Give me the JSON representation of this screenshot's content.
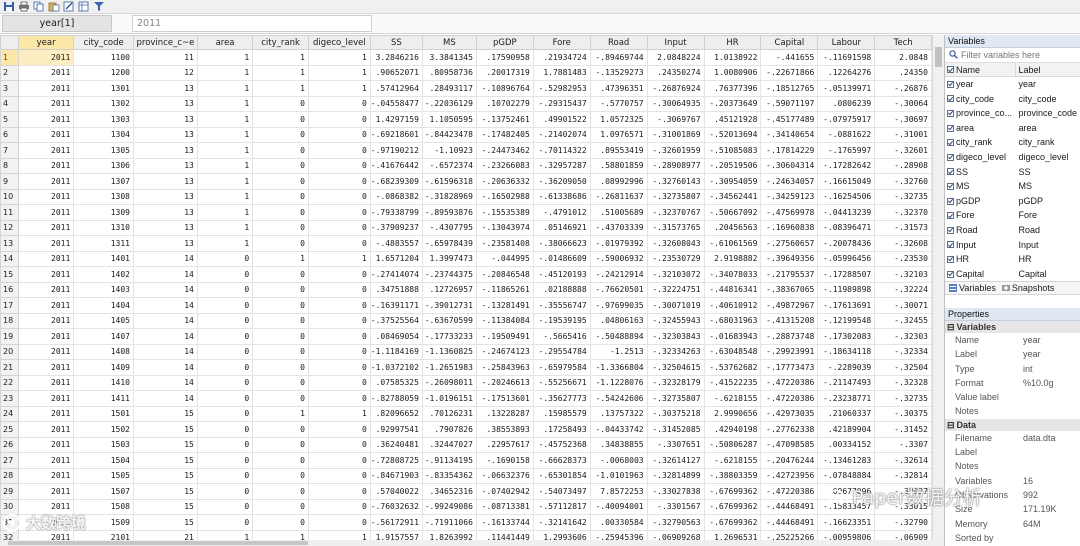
{
  "toolbar": {
    "icons": [
      "save-icon",
      "print-icon",
      "copy-icon",
      "paste-icon",
      "edit-icon",
      "browse-icon",
      "filter-icon"
    ]
  },
  "editbar": {
    "varname": "year[1]",
    "value": "2011"
  },
  "grid": {
    "columns": [
      "year",
      "city_code",
      "province_c~e",
      "area",
      "city_rank",
      "digeco_level",
      "SS",
      "MS",
      "pGDP",
      "Fore",
      "Road",
      "Input",
      "HR",
      "Capital",
      "Labour",
      "Tech"
    ],
    "rows": [
      [
        "1",
        "2011",
        "1100",
        "11",
        "1",
        "1",
        "1",
        "3.2846216",
        "3.3841345",
        ".17590958",
        ".21934724",
        "-.89469744",
        "2.0848224",
        "1.0138922",
        "-.441655",
        "-.11691598",
        "2.0848"
      ],
      [
        "2",
        "2011",
        "1200",
        "12",
        "1",
        "1",
        "1",
        ".90652071",
        ".80958736",
        ".20017319",
        "1.7881483",
        "-.13529273",
        ".24350274",
        "1.0080906",
        "-.22671866",
        ".12264276",
        ".24350"
      ],
      [
        "3",
        "2011",
        "1301",
        "13",
        "1",
        "1",
        "1",
        ".57412964",
        ".28493117",
        "-.10896764",
        "-.52982953",
        ".47396351",
        "-.26876924",
        ".76377396",
        "-.18512765",
        "-.05139971",
        "-.26876"
      ],
      [
        "4",
        "2011",
        "1302",
        "13",
        "1",
        "0",
        "0",
        "-.04558477",
        "-.22036129",
        ".10702279",
        "-.29315437",
        "-.5770757",
        "-.30064935",
        "-.20373649",
        "-.59071197",
        ".0806239",
        "-.30064"
      ],
      [
        "5",
        "2011",
        "1303",
        "13",
        "1",
        "0",
        "0",
        "1.4297159",
        "1.1050595",
        "-.13752461",
        ".49901522",
        "1.0572325",
        "-.3069767",
        ".45121928",
        "-.45177489",
        "-.07975917",
        "-.30697"
      ],
      [
        "6",
        "2011",
        "1304",
        "13",
        "1",
        "0",
        "0",
        "-.69218601",
        "-.84423478",
        "-.17482405",
        "-.21402074",
        "1.0976571",
        "-.31001869",
        "-.52013694",
        "-.34140654",
        "-.0881622",
        "-.31001"
      ],
      [
        "7",
        "2011",
        "1305",
        "13",
        "1",
        "0",
        "0",
        "-.97190212",
        "-1.10923",
        "-.24473462",
        "-.70114322",
        ".89553419",
        "-.32601959",
        "-.51085083",
        "-.17814229",
        "-.1765997",
        "-.32601"
      ],
      [
        "8",
        "2011",
        "1306",
        "13",
        "1",
        "0",
        "0",
        "-.41676442",
        "-.6572374",
        "-.23266083",
        "-.32957287",
        ".58801859",
        "-.28908977",
        "-.20519506",
        "-.30604314",
        "-.17282642",
        "-.28908"
      ],
      [
        "9",
        "2011",
        "1307",
        "13",
        "1",
        "0",
        "0",
        "-.68239309",
        "-.61596318",
        "-.20636332",
        "-.36209050",
        ".08992996",
        "-.32760143",
        "-.30954059",
        "-.24634057",
        "-.16615049",
        "-.32760"
      ],
      [
        "10",
        "2011",
        "1308",
        "13",
        "1",
        "0",
        "0",
        "-.0868382",
        "-.31828969",
        "-.16502988",
        "-.61338686",
        "-.26811637",
        "-.32735807",
        "-.34562441",
        "-.34259123",
        "-.16254506",
        "-.32735"
      ],
      [
        "11",
        "2011",
        "1309",
        "13",
        "1",
        "0",
        "0",
        "-.79338799",
        "-.89593876",
        "-.15535389",
        "-.4791012",
        ".51005689",
        "-.32370767",
        "-.50667092",
        "-.47569978",
        "-.04413239",
        "-.32370"
      ],
      [
        "12",
        "2011",
        "1310",
        "13",
        "1",
        "0",
        "0",
        "-.37909237",
        "-.4307795",
        "-.13043974",
        ".05146921",
        "-.43703339",
        "-.31573765",
        ".20456563",
        "-.16960838",
        "-.08396471",
        "-.31573"
      ],
      [
        "13",
        "2011",
        "1311",
        "13",
        "1",
        "0",
        "0",
        "-.4883557",
        "-.65978439",
        "-.23581408",
        "-.38066623",
        "-.01979392",
        "-.32608043",
        "-.61061569",
        "-.27560657",
        "-.20078436",
        "-.32608"
      ],
      [
        "14",
        "2011",
        "1401",
        "14",
        "0",
        "1",
        "1",
        "1.6571204",
        "1.3997473",
        "-.044995",
        "-.01486609",
        "-.59006932",
        "-.23530729",
        "2.9198882",
        "-.39649356",
        "-.05996456",
        "-.23530"
      ],
      [
        "15",
        "2011",
        "1402",
        "14",
        "0",
        "0",
        "0",
        "-.27414074",
        "-.23744375",
        "-.20846548",
        "-.45120193",
        "-.24212914",
        "-.32103072",
        "-.34078033",
        "-.21795537",
        "-.17288507",
        "-.32103"
      ],
      [
        "16",
        "2011",
        "1403",
        "14",
        "0",
        "0",
        "0",
        ".34751888",
        ".12726957",
        "-.11865261",
        ".02188888",
        "-.76620501",
        "-.32224751",
        "-.44816341",
        "-.38367065",
        "-.11989898",
        "-.32224"
      ],
      [
        "17",
        "2011",
        "1404",
        "14",
        "0",
        "0",
        "0",
        "-.16391171",
        "-.39012731",
        "-.13281491",
        "-.35556747",
        "-.97699035",
        "-.30071019",
        "-.40610912",
        "-.49872967",
        "-.17613691",
        "-.30071"
      ],
      [
        "18",
        "2011",
        "1405",
        "14",
        "0",
        "0",
        "0",
        "-.37525564",
        "-.63670599",
        "-.11384084",
        "-.19539195",
        ".04806163",
        "-.32455943",
        "-.68031963",
        "-.41315208",
        "-.12199548",
        "-.32455"
      ],
      [
        "19",
        "2011",
        "1407",
        "14",
        "0",
        "0",
        "0",
        ".08469054",
        "-.17733233",
        "-.19509491",
        "-.5665416",
        "-.50488894",
        "-.32303843",
        "-.01683943",
        "-.28873748",
        "-.17302083",
        "-.32303"
      ],
      [
        "20",
        "2011",
        "1408",
        "14",
        "0",
        "0",
        "0",
        "-1.1184169",
        "-1.1360825",
        "-.24674123",
        "-.29554784",
        "-1.2513",
        "-.32334263",
        "-.63048548",
        "-.29923991",
        "-.18634118",
        "-.32334"
      ],
      [
        "21",
        "2011",
        "1409",
        "14",
        "0",
        "0",
        "0",
        "-1.0372102",
        "-1.2651983",
        "-.25843963",
        "-.65979584",
        "-1.3366804",
        "-.32504615",
        "-.53762682",
        "-.17773473",
        "-.2289039",
        "-.32504"
      ],
      [
        "22",
        "2011",
        "1410",
        "14",
        "0",
        "0",
        "0",
        ".07585325",
        "-.26098011",
        "-.20246613",
        "-.55256671",
        "-1.1228076",
        "-.32328179",
        "-.41522235",
        "-.47220386",
        "-.21147493",
        "-.32328"
      ],
      [
        "23",
        "2011",
        "1411",
        "14",
        "0",
        "0",
        "0",
        "-.82788059",
        "-1.0196151",
        "-.17513601",
        "-.35627773",
        "-.54242606",
        "-.32735807",
        "-.6218155",
        "-.47220386",
        "-.23238771",
        "-.32735"
      ],
      [
        "24",
        "2011",
        "1501",
        "15",
        "0",
        "1",
        "1",
        ".82096652",
        ".70126231",
        ".13228287",
        ".15985579",
        ".13757322",
        "-.30375218",
        "2.9990656",
        "-.42973035",
        ".21060337",
        "-.30375"
      ],
      [
        "25",
        "2011",
        "1502",
        "15",
        "0",
        "0",
        "0",
        ".92997541",
        ".7907826",
        ".38553893",
        ".17258493",
        "-.04433742",
        "-.31452085",
        ".42940198",
        "-.27762338",
        ".42189904",
        "-.31452"
      ],
      [
        "26",
        "2011",
        "1503",
        "15",
        "0",
        "0",
        "0",
        ".36240481",
        ".32447027",
        ".22957617",
        "-.45752368",
        ".34838855",
        "-.3307651",
        "-.50806287",
        "-.47098585",
        ".00334152",
        "-.3307"
      ],
      [
        "27",
        "2011",
        "1504",
        "15",
        "0",
        "0",
        "0",
        "-.72808725",
        "-.91134195",
        "-.1690158",
        "-.66628373",
        "-.0068003",
        "-.32614127",
        "-.6218155",
        "-.20476244",
        "-.13461283",
        "-.32614"
      ],
      [
        "28",
        "2011",
        "1505",
        "15",
        "0",
        "0",
        "0",
        "-.84671903",
        "-.83354362",
        "-.06632376",
        "-.65301854",
        "-1.0101963",
        "-.32814899",
        "-.38803359",
        "-.42723956",
        "-.07848884",
        "-.32814"
      ],
      [
        "29",
        "2011",
        "1507",
        "15",
        "0",
        "0",
        "0",
        ".57040022",
        ".34652316",
        "-.07402942",
        "-.54073497",
        "7.8572253",
        "-.33027838",
        "-.67699362",
        "-.47220386",
        ".09677096",
        "-.33027"
      ],
      [
        "30",
        "2011",
        "1508",
        "15",
        "0",
        "0",
        "0",
        "-.76032632",
        "-.99249086",
        "-.08713381",
        "-.57112817",
        "-.40094001",
        "-.3301567",
        "-.67699362",
        "-.44468491",
        "-.15833457",
        "-.33015"
      ],
      [
        "31",
        "2011",
        "1509",
        "15",
        "0",
        "0",
        "0",
        "-.56172911",
        "-.71911066",
        "-.16133744",
        "-.32141642",
        ".00330584",
        "-.32790563",
        "-.67699362",
        "-.44468491",
        "-.16623351",
        "-.32790"
      ],
      [
        "32",
        "2011",
        "2101",
        "21",
        "1",
        "1",
        "1",
        "1.9157557",
        "1.8263992",
        ".11441449",
        "1.2993606",
        "-.25945396",
        "-.06909268",
        "1.2696531",
        "-.25225266",
        "-.00959806",
        "-.06909"
      ]
    ]
  },
  "variables_panel": {
    "title": "Variables",
    "filter_placeholder": "Filter variables here",
    "col_name": "Name",
    "col_label": "Label",
    "items": [
      {
        "name": "year",
        "label": "year"
      },
      {
        "name": "city_code",
        "label": "city_code"
      },
      {
        "name": "province_co...",
        "label": "province_code"
      },
      {
        "name": "area",
        "label": "area"
      },
      {
        "name": "city_rank",
        "label": "city_rank"
      },
      {
        "name": "digeco_level",
        "label": "digeco_level"
      },
      {
        "name": "SS",
        "label": "SS"
      },
      {
        "name": "MS",
        "label": "MS"
      },
      {
        "name": "pGDP",
        "label": "pGDP"
      },
      {
        "name": "Fore",
        "label": "Fore"
      },
      {
        "name": "Road",
        "label": "Road"
      },
      {
        "name": "Input",
        "label": "Input"
      },
      {
        "name": "HR",
        "label": "HR"
      },
      {
        "name": "Capital",
        "label": "Capital"
      }
    ],
    "tab_variables": "Variables",
    "tab_snapshots": "Snapshots"
  },
  "properties_panel": {
    "title": "Properties",
    "section_variables": "Variables",
    "variable_props": [
      {
        "key": "Name",
        "value": "year"
      },
      {
        "key": "Label",
        "value": "year"
      },
      {
        "key": "Type",
        "value": "int"
      },
      {
        "key": "Format",
        "value": "%10.0g"
      },
      {
        "key": "Value label",
        "value": ""
      },
      {
        "key": "Notes",
        "value": ""
      }
    ],
    "section_data": "Data",
    "data_props": [
      {
        "key": "Filename",
        "value": "data.dta"
      },
      {
        "key": "Label",
        "value": ""
      },
      {
        "key": "Notes",
        "value": ""
      },
      {
        "key": "Variables",
        "value": "16"
      },
      {
        "key": "Observations",
        "value": "992"
      },
      {
        "key": "Size",
        "value": "171.19K"
      },
      {
        "key": "Memory",
        "value": "64M"
      },
      {
        "key": "Sorted by",
        "value": ""
      }
    ]
  },
  "watermarks": {
    "left": "大数跨境",
    "right": "Paper数据分析"
  },
  "colors": {
    "selected_header": "#fbe7a6",
    "panel_title_bg": "#dfe8f3",
    "row_number_highlight": "#b02020"
  }
}
